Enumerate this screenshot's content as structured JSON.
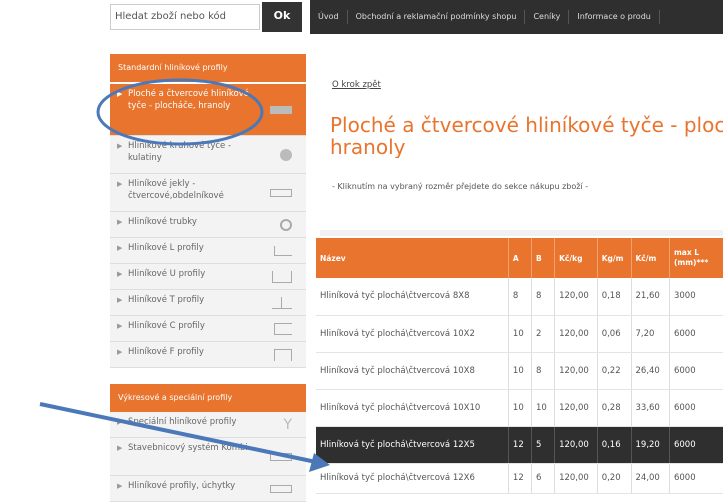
{
  "search": {
    "placeholder": "Hledat zboží nebo kód",
    "button": "Ok"
  },
  "nav": [
    "Úvod",
    "Obchodní a reklamační podmínky shopu",
    "Ceníky",
    "Informace o produ"
  ],
  "sidebar": {
    "section1_title": "Standardní hliníkové profily",
    "items": [
      {
        "label": "Ploché a čtvercové hliníkové tyče - plocháče, hranoly",
        "icon": "flat-bar-icon"
      },
      {
        "label": "Hliníkové kruhové tyče - kulatiny",
        "icon": "round-bar-icon"
      },
      {
        "label": "Hliníkové jekly - čtvercové,obdelníkové",
        "icon": "rect-tube-icon"
      },
      {
        "label": "Hliníkové trubky",
        "icon": "tube-icon"
      },
      {
        "label": "Hliníkové L profily",
        "icon": "l-profile-icon"
      },
      {
        "label": "Hliníkové U profily",
        "icon": "u-profile-icon"
      },
      {
        "label": "Hliníkové T profily",
        "icon": "t-profile-icon"
      },
      {
        "label": "Hliníkové C profily",
        "icon": "c-profile-icon"
      },
      {
        "label": "Hliníkové F profily",
        "icon": "f-profile-icon"
      }
    ],
    "section2_title": "Výkresové a speciální profily",
    "items2": [
      {
        "label": "Speciální hliníkové profily",
        "icon": "special-profile-icon"
      },
      {
        "label": "Stavebnicový systém Kombi",
        "icon": "kombi-icon"
      },
      {
        "label": "Hliníkové profily, úchytky",
        "icon": "handle-icon"
      }
    ]
  },
  "main": {
    "back_link": "O krok zpět",
    "title_line1": "Ploché a čtvercové hliníkové tyče - plocháče,",
    "title_line2": "hranoly",
    "note": "- Kliknutím na vybraný rozměr přejdete do sekce nákupu zboží -"
  },
  "table": {
    "headers": [
      "Název",
      "A",
      "B",
      "Kč/kg",
      "Kg/m",
      "Kč/m",
      "max L (mm)***"
    ],
    "rows": [
      [
        "Hliníková tyč plochá\\čtvercová 8X8",
        "8",
        "8",
        "120,00",
        "0,18",
        "21,60",
        "3000"
      ],
      [
        "Hliníková tyč plochá\\čtvercová 10X2",
        "10",
        "2",
        "120,00",
        "0,06",
        "7,20",
        "6000"
      ],
      [
        "Hliníková tyč plochá\\čtvercová 10X8",
        "10",
        "8",
        "120,00",
        "0,22",
        "26,40",
        "6000"
      ],
      [
        "Hliníková tyč plochá\\čtvercová 10X10",
        "10",
        "10",
        "120,00",
        "0,28",
        "33,60",
        "6000"
      ],
      [
        "Hliníková tyč plochá\\čtvercová 12X5",
        "12",
        "5",
        "120,00",
        "0,16",
        "19,20",
        "6000"
      ],
      [
        "Hliníková tyč plochá\\čtvercová 12X6",
        "12",
        "6",
        "120,00",
        "0,20",
        "24,00",
        "6000"
      ]
    ]
  },
  "colors": {
    "accent": "#e8742d",
    "dark": "#2f2f2f",
    "annotation": "#4a78b8"
  }
}
